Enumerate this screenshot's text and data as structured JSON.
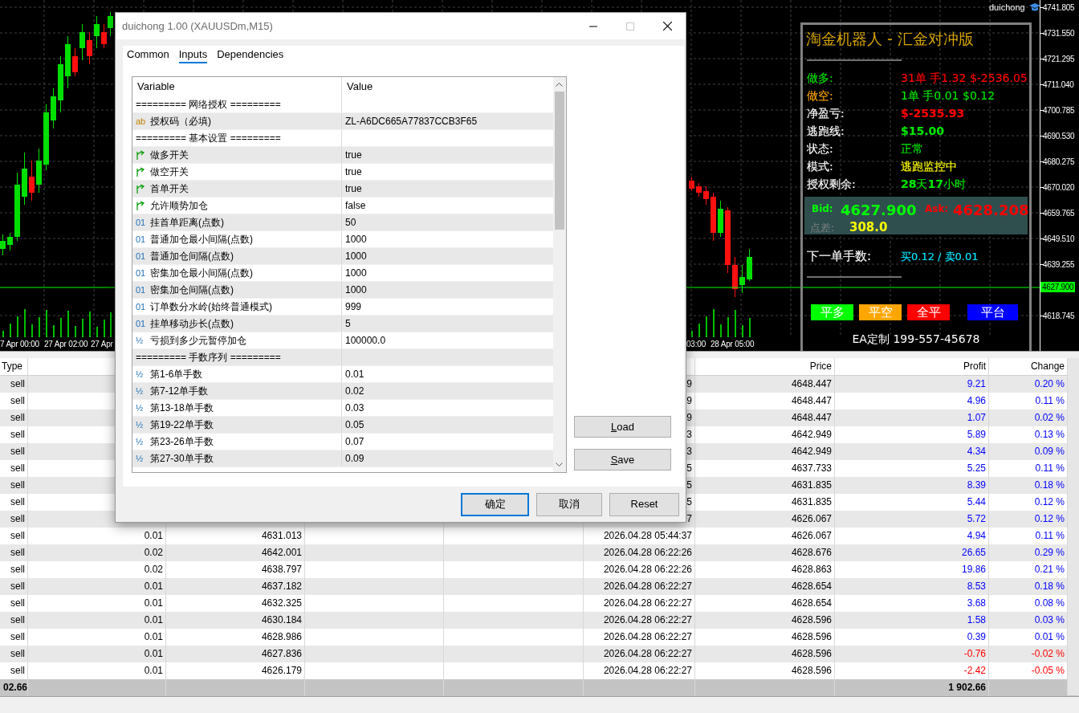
{
  "chart": {
    "symbol_label": "duichong",
    "price_axis": [
      "4741.805",
      "4731.550",
      "4721.295",
      "4711.040",
      "4700.785",
      "4690.530",
      "4680.275",
      "4670.020",
      "4659.765",
      "4649.510",
      "4639.255",
      "4618.745"
    ],
    "current_price": "4627.900",
    "time_axis": [
      "7 Apr 00:00",
      "27 Apr 02:00",
      "27 Apr",
      "03:00",
      "28 Apr 05:00"
    ]
  },
  "panel": {
    "title": "淘金机器人 - 汇金对冲版",
    "rows": [
      {
        "label": {
          "text": "做多:",
          "color": "#00e600"
        },
        "value": {
          "text": "31单 手1.32 $-2536.05",
          "color": "#ff0000",
          "bold": false
        }
      },
      {
        "label": {
          "text": "做空:",
          "color": "#ffa500"
        },
        "value": {
          "text": "1单 手0.01 $0.12",
          "color": "#00e600",
          "bold": false
        }
      },
      {
        "label": {
          "text": "净盈亏:",
          "color": "#ffffff"
        },
        "value": {
          "text": "$-2535.93",
          "color": "#ff0000",
          "bold": true
        }
      },
      {
        "label": {
          "text": "逃跑线:",
          "color": "#ffffff"
        },
        "value": {
          "text": "$15.00",
          "color": "#00e600",
          "bold": true
        }
      },
      {
        "label": {
          "text": "状态:",
          "color": "#ffffff"
        },
        "value": {
          "text": "正常",
          "color": "#00e600",
          "bold": false
        }
      },
      {
        "label": {
          "text": "模式:",
          "color": "#ffffff"
        },
        "value": {
          "text": "逃跑监控中",
          "color": "#ffff00",
          "bold": false
        }
      },
      {
        "label": {
          "text": "授权剩余:",
          "color": "#ffffff"
        },
        "value": {
          "text": "**28**天**17**小时",
          "color": "#00e600",
          "bold": false
        }
      }
    ],
    "quote": [
      {
        "label": {
          "text": "Bid:",
          "color": "#00ff00"
        },
        "value": {
          "text": "4627.900",
          "color": "#00ff00"
        }
      },
      {
        "label": {
          "text": "Ask:",
          "color": "#ff0000"
        },
        "value": {
          "text": "4628.208",
          "color": "#ff0000"
        }
      },
      {
        "label": {
          "text": "点差:",
          "color": "#808080"
        },
        "value": {
          "text": "308.0",
          "color": "#ffff00"
        }
      }
    ],
    "next_lot": {
      "label": "下一单手数:",
      "value": "买0.12 / 卖0.01"
    },
    "buttons": [
      {
        "label": "平多",
        "color": "#00ff00"
      },
      {
        "label": "平空",
        "color": "#ffa500"
      },
      {
        "label": "全平",
        "color": "#ff0000"
      },
      {
        "label": "平台",
        "color": "#0000ff"
      }
    ],
    "footer": "EA定制  199-557-45678"
  },
  "dialog": {
    "title": "duichong 1.00 (XAUUSDm,M15)",
    "tabs": [
      {
        "label": "Common",
        "selected": false
      },
      {
        "label": "Inputs",
        "selected": true
      },
      {
        "label": "Dependencies",
        "selected": false
      }
    ],
    "columns": [
      "Variable",
      "Value"
    ],
    "params": [
      {
        "kind": "section",
        "name": "========= 网络授权 ========="
      },
      {
        "kind": "string",
        "icon": "ab",
        "name": "授权码（必填)",
        "value": "ZL-A6DC665A77837CCB3F65"
      },
      {
        "kind": "section",
        "name": "========= 基本设置 ========="
      },
      {
        "kind": "bool",
        "name": "做多开关",
        "value": "true"
      },
      {
        "kind": "bool",
        "name": "做空开关",
        "value": "true"
      },
      {
        "kind": "bool",
        "name": "首单开关",
        "value": "true"
      },
      {
        "kind": "bool",
        "name": "允许顺势加仓",
        "value": "false"
      },
      {
        "kind": "int",
        "icon": "01",
        "name": "挂首单距离(点数)",
        "value": "50"
      },
      {
        "kind": "int",
        "icon": "01",
        "name": "普通加仓最小间隔(点数)",
        "value": "1000"
      },
      {
        "kind": "int",
        "icon": "01",
        "name": "普通加仓间隔(点数)",
        "value": "1000"
      },
      {
        "kind": "int",
        "icon": "01",
        "name": "密集加仓最小间隔(点数)",
        "value": "1000"
      },
      {
        "kind": "int",
        "icon": "01",
        "name": "密集加仓间隔(点数)",
        "value": "1000"
      },
      {
        "kind": "int",
        "icon": "01",
        "name": "订单数分水岭(始终普通模式)",
        "value": "999"
      },
      {
        "kind": "int",
        "icon": "01",
        "name": "挂单移动步长(点数)",
        "value": "5"
      },
      {
        "kind": "double",
        "icon": "½",
        "name": "亏损到多少元暂停加仓",
        "value": "100000.0"
      },
      {
        "kind": "section",
        "name": "========= 手数序列 ========="
      },
      {
        "kind": "double",
        "icon": "½",
        "name": "第1-6单手数",
        "value": "0.01"
      },
      {
        "kind": "double",
        "icon": "½",
        "name": "第7-12单手数",
        "value": "0.02"
      },
      {
        "kind": "double",
        "icon": "½",
        "name": "第13-18单手数",
        "value": "0.03"
      },
      {
        "kind": "double",
        "icon": "½",
        "name": "第19-22单手数",
        "value": "0.05"
      },
      {
        "kind": "double",
        "icon": "½",
        "name": "第23-26单手数",
        "value": "0.07"
      },
      {
        "kind": "double",
        "icon": "½",
        "name": "第27-30单手数",
        "value": "0.09"
      }
    ],
    "side_buttons": [
      "Load",
      "Save"
    ],
    "buttons": [
      {
        "label": "确定",
        "default": true
      },
      {
        "label": "取消",
        "default": false
      },
      {
        "label": "Reset",
        "default": false
      }
    ]
  },
  "table": {
    "header": {
      "type": "Type",
      "price": "Price",
      "profit": "Profit",
      "change": "Change"
    },
    "rows": [
      {
        "type": "sell",
        "time": "9",
        "price": "4648.447",
        "profit": "9.21",
        "change": "0.20 %",
        "loss": false
      },
      {
        "type": "sell",
        "time": "9",
        "price": "4648.447",
        "profit": "4.96",
        "change": "0.11 %",
        "loss": false
      },
      {
        "type": "sell",
        "time": "9",
        "price": "4648.447",
        "profit": "1.07",
        "change": "0.02 %",
        "loss": false
      },
      {
        "type": "sell",
        "time": "3",
        "price": "4642.949",
        "profit": "5.89",
        "change": "0.13 %",
        "loss": false
      },
      {
        "type": "sell",
        "time": "3",
        "price": "4642.949",
        "profit": "4.34",
        "change": "0.09 %",
        "loss": false
      },
      {
        "type": "sell",
        "time": "5",
        "price": "4637.733",
        "profit": "5.25",
        "change": "0.11 %",
        "loss": false
      },
      {
        "type": "sell",
        "time": "5",
        "price": "4631.835",
        "profit": "8.39",
        "change": "0.18 %",
        "loss": false
      },
      {
        "type": "sell",
        "time": "5",
        "price": "4631.835",
        "profit": "5.44",
        "change": "0.12 %",
        "loss": false
      },
      {
        "type": "sell",
        "time": "7",
        "price": "4626.067",
        "profit": "5.72",
        "change": "0.12 %",
        "loss": false
      },
      {
        "type": "sell",
        "volume": "0.01",
        "open_price": "4631.013",
        "time": "2026.04.28 05:44:37",
        "price": "4626.067",
        "profit": "4.94",
        "change": "0.11 %",
        "loss": false
      },
      {
        "type": "sell",
        "volume": "0.02",
        "open_price": "4642.001",
        "time": "2026.04.28 06:22:26",
        "price": "4628.676",
        "profit": "26.65",
        "change": "0.29 %",
        "loss": false
      },
      {
        "type": "sell",
        "volume": "0.02",
        "open_price": "4638.797",
        "time": "2026.04.28 06:22:26",
        "price": "4628.863",
        "profit": "19.86",
        "change": "0.21 %",
        "loss": false
      },
      {
        "type": "sell",
        "volume": "0.01",
        "open_price": "4637.182",
        "time": "2026.04.28 06:22:27",
        "price": "4628.654",
        "profit": "8.53",
        "change": "0.18 %",
        "loss": false
      },
      {
        "type": "sell",
        "volume": "0.01",
        "open_price": "4632.325",
        "time": "2026.04.28 06:22:27",
        "price": "4628.654",
        "profit": "3.68",
        "change": "0.08 %",
        "loss": false
      },
      {
        "type": "sell",
        "volume": "0.01",
        "open_price": "4630.184",
        "time": "2026.04.28 06:22:27",
        "price": "4628.596",
        "profit": "1.58",
        "change": "0.03 %",
        "loss": false
      },
      {
        "type": "sell",
        "volume": "0.01",
        "open_price": "4628.986",
        "time": "2026.04.28 06:22:27",
        "price": "4628.596",
        "profit": "0.39",
        "change": "0.01 %",
        "loss": false
      },
      {
        "type": "sell",
        "volume": "0.01",
        "open_price": "4627.836",
        "time": "2026.04.28 06:22:27",
        "price": "4628.596",
        "profit": "-0.76",
        "change": "-0.02 %",
        "loss": true
      },
      {
        "type": "sell",
        "volume": "0.01",
        "open_price": "4626.179",
        "time": "2026.04.28 06:22:27",
        "price": "4628.596",
        "profit": "-2.42",
        "change": "-0.05 %",
        "loss": true
      }
    ],
    "total": {
      "balance": "02.66",
      "profit": "1 902.66"
    }
  }
}
